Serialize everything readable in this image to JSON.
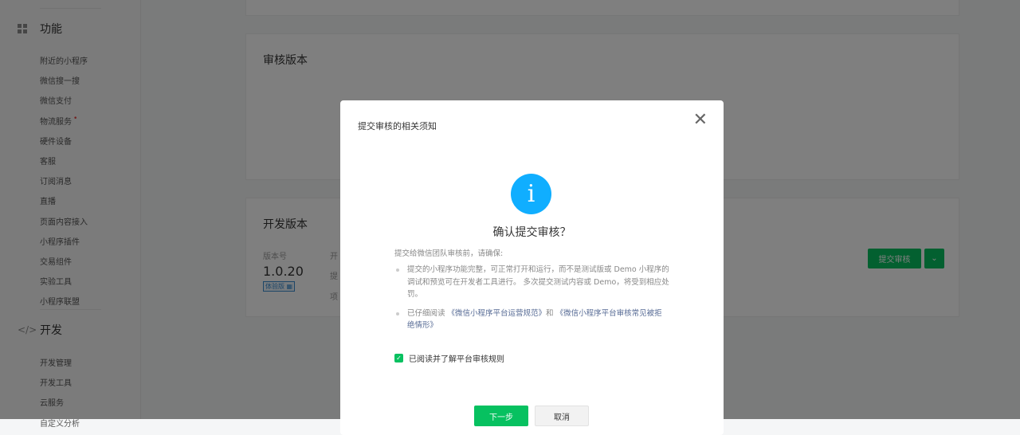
{
  "sidebar": {
    "sections": [
      {
        "title": "功能",
        "icon": "grid-icon",
        "items": [
          "附近的小程序",
          "微信搜一搜",
          "微信支付",
          "物流服务",
          "硬件设备",
          "客服",
          "订阅消息",
          "直播",
          "页面内容接入",
          "小程序插件",
          "交易组件",
          "实验工具",
          "小程序联盟"
        ]
      },
      {
        "title": "开发",
        "icon": "code-icon",
        "items": [
          "开发管理",
          "开发工具",
          "云服务",
          "自定义分析"
        ]
      }
    ],
    "new_dot": "•"
  },
  "main": {
    "review_card": {
      "title": "审核版本"
    },
    "dev_card": {
      "title": "开发版本",
      "version_label": "版本号",
      "version": "1.0.20",
      "badge": "体验版",
      "col2_labels": [
        "开",
        "提",
        "项"
      ],
      "submit_button": "提交审核",
      "dropdown_icon": "chevron-down-icon"
    }
  },
  "modal": {
    "title": "提交审核的相关须知",
    "heading": "确认提交审核？",
    "intro": "提交给微信团队审核前，请确保:",
    "item1": "提交的小程序功能完整，可正常打开和运行，而不是测试版或 Demo 小程序的调试和预览可在开发者工具进行。 多次提交测试内容或 Demo，将受到相应处罚。",
    "item2_prefix": "已仔细阅读 ",
    "item2_link1": "《微信小程序平台运营规范》",
    "item2_mid": "和 ",
    "item2_link2": "《微信小程序平台审核常见被拒绝情形》",
    "checkbox_label": "已阅读并了解平台审核规则",
    "checkbox_checked": true,
    "next_button": "下一步",
    "cancel_button": "取消"
  },
  "colors": {
    "brand": "#07c160",
    "info": "#10aeff",
    "link": "#576b95"
  }
}
